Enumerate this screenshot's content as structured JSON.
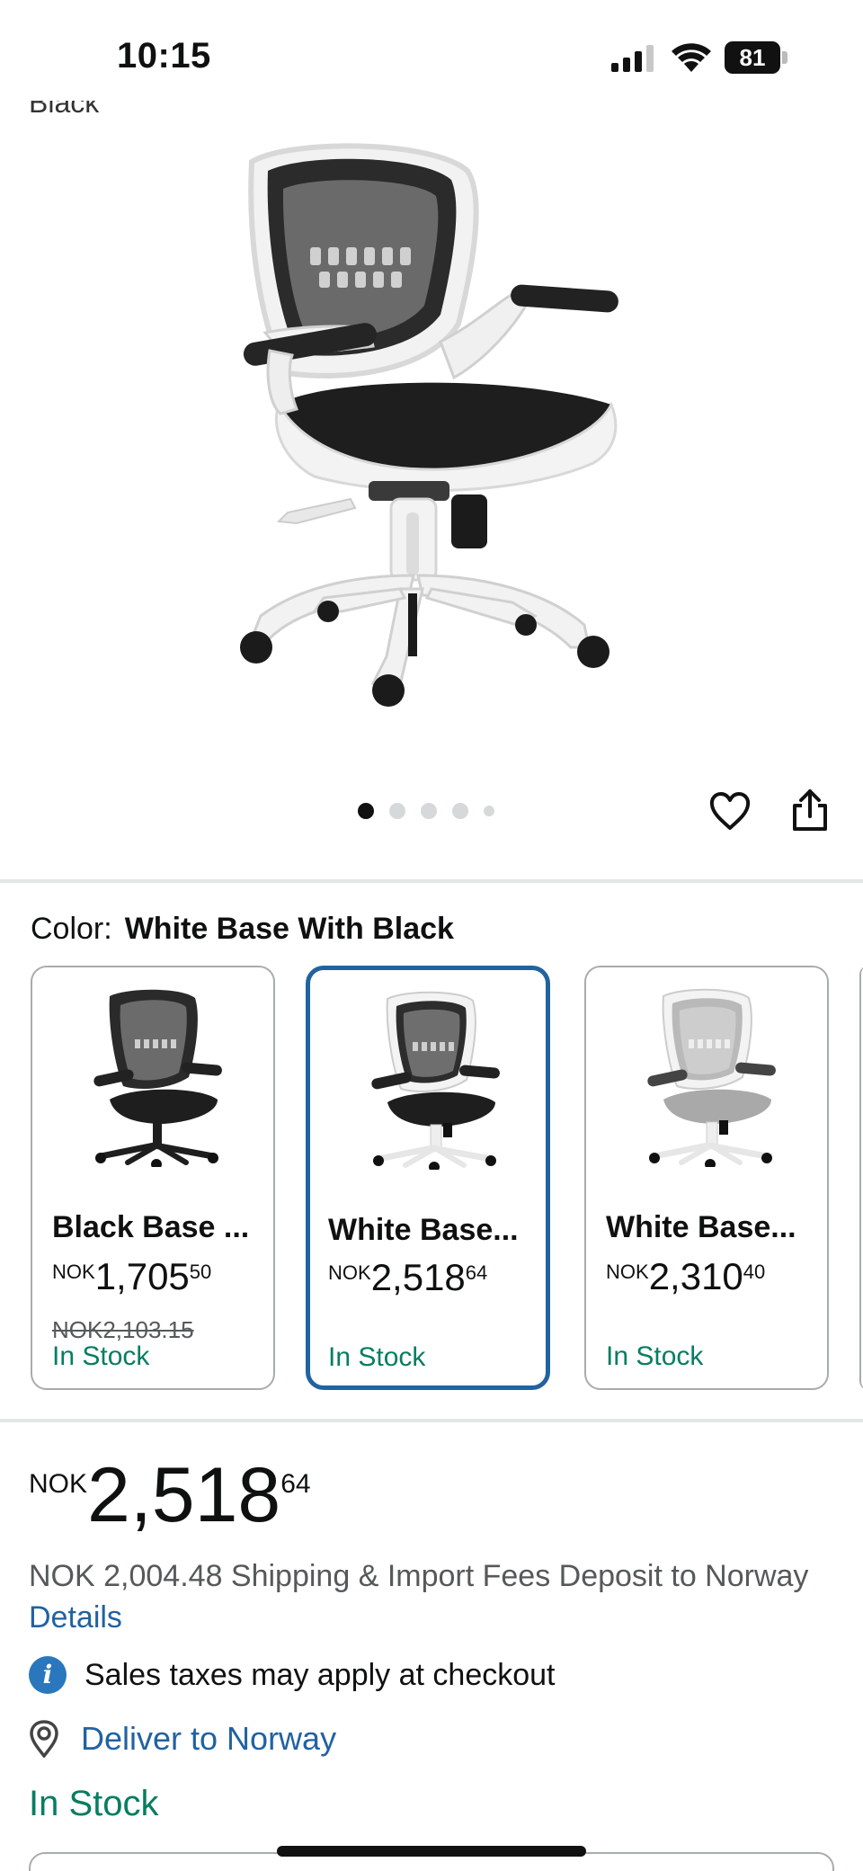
{
  "status_bar": {
    "time": "10:15",
    "battery": "81"
  },
  "gallery": {
    "clipped_text": "Black",
    "image": "white-base-office-chair",
    "dot_count": 5,
    "active_dot": 0
  },
  "actions": {
    "favorite_icon": "heart-icon",
    "share_icon": "share-icon"
  },
  "color": {
    "label": "Color:",
    "selected_value": "White Base With Black"
  },
  "swatches": [
    {
      "name": "Black Base ...",
      "currency": "NOK",
      "price_whole": "1,705",
      "price_fraction": "50",
      "old_price": "NOK2,103.15",
      "stock": "In Stock",
      "selected": false
    },
    {
      "name": "White Base...",
      "currency": "NOK",
      "price_whole": "2,518",
      "price_fraction": "64",
      "stock": "In Stock",
      "selected": true
    },
    {
      "name": "White Base...",
      "currency": "NOK",
      "price_whole": "2,310",
      "price_fraction": "40",
      "stock": "In Stock",
      "selected": false
    }
  ],
  "price": {
    "currency": "NOK",
    "whole": "2,518",
    "fraction": "64"
  },
  "shipping": {
    "text": "NOK 2,004.48 Shipping & Import Fees Deposit to Norway",
    "link": "Details"
  },
  "tax_note": "Sales taxes may apply at checkout",
  "deliver_to": "Deliver to Norway",
  "availability": "In Stock",
  "colors": {
    "link": "#2162a1",
    "in_stock": "#067d62",
    "selected_border": "#2163a0",
    "info_icon": "#2a77bd"
  }
}
